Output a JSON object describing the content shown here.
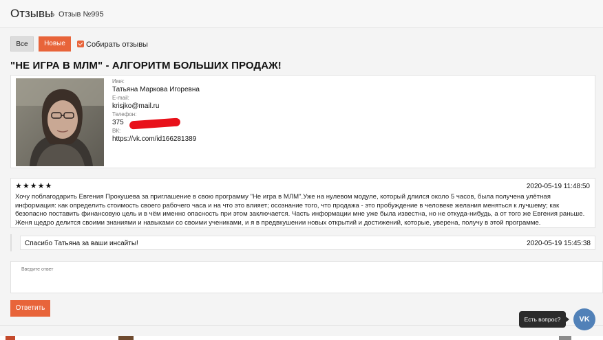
{
  "header": {
    "title": "Отзывы",
    "separator": "»",
    "breadcrumb": "Отзыв №995"
  },
  "filters": {
    "all_label": "Все",
    "new_label": "Новые",
    "collect_label": "Собирать отзывы",
    "collect_checked": true
  },
  "heading": "\"НЕ ИГРА В МЛМ\" - АЛГОРИТМ БОЛЬШИХ ПРОДАЖ!",
  "profile": {
    "name_label": "Имя:",
    "name": "Татьяна Маркова Игоревна",
    "email_label": "E-mail:",
    "email": "krisjko@mail.ru",
    "phone_label": "Телефон:",
    "phone": "375",
    "vk_label": "ВК:",
    "vk": "https://vk.com/id166281389"
  },
  "review": {
    "rating": 5,
    "stars": "★★★★★",
    "date": "2020-05-19 11:48:50",
    "text": "Хочу поблагодарить Евгения Прокушева за приглашение в свою программу \"Не игра в МЛМ\".Уже на нулевом модуле, который длился около 5 часов, была получена улётная информация: как определить стоимость своего рабочего часа и на что это влияет; осознание того, что продажа - это пробуждение в человеке желания меняться к лучшему; как безопасно поставить финансовую цель и в чём именно опасность при этом заключается. Часть информации мне уже была известна, но не откуда-нибудь, а от того же Евгения раньше. Женя щедро делится своими знаниями и навыками со своими учениками, и я в предвкушении новых открытий и достижений, которые, уверена, получу в этой программе."
  },
  "reply": {
    "text": "Спасибо Татьяна за ваши инсайты!",
    "date": "2020-05-19 15:45:38"
  },
  "answer": {
    "placeholder": "Введите ответ",
    "submit_label": "Ответить"
  },
  "widget": {
    "tooltip": "Есть вопрос?",
    "vk_label": "VK"
  },
  "colors": {
    "accent": "#e8643a",
    "vk": "#5181b8"
  }
}
